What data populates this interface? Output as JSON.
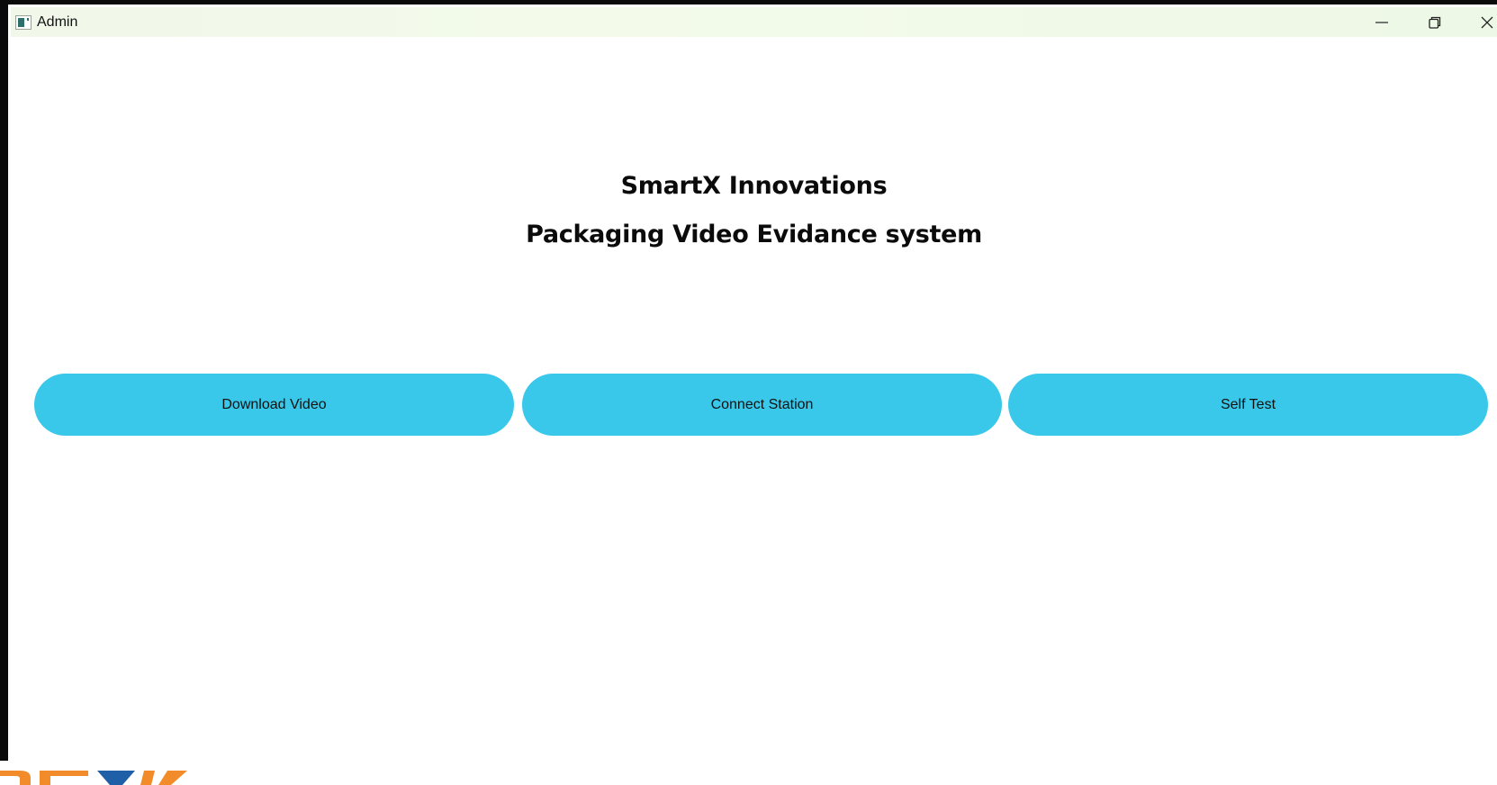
{
  "window": {
    "title": "Admin",
    "controls": {
      "minimize_icon": "minimize-icon",
      "restore_icon": "restore-icon",
      "close_icon": "close-icon"
    }
  },
  "main": {
    "heading_company": "SmartX Innovations",
    "heading_system": "Packaging Video Evidance system",
    "buttons": [
      {
        "label": "Download Video"
      },
      {
        "label": "Connect Station"
      },
      {
        "label": "Self Test"
      }
    ]
  },
  "colors": {
    "button_fill": "#3ac8ea",
    "titlebar": "#f1f8e9",
    "logo_orange": "#f28c2a",
    "logo_blue": "#1f5fa8"
  }
}
